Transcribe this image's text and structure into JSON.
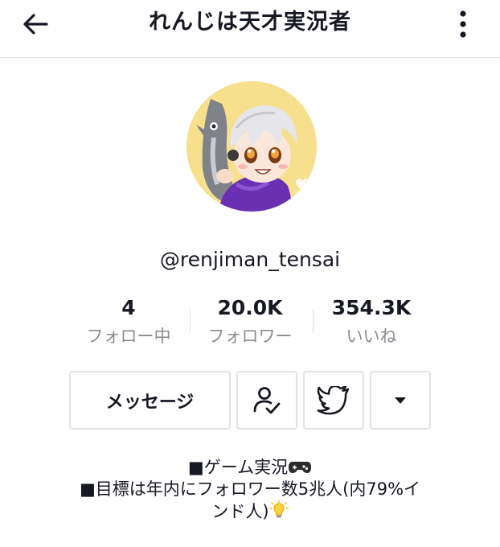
{
  "header": {
    "title": "れんじは天才実況者",
    "back_icon": "arrow-left-icon",
    "more_icon": "vertical-dots-icon"
  },
  "profile": {
    "avatar_icon": "anime-avatar-with-shark",
    "username": "@renjiman_tensai"
  },
  "stats": [
    {
      "value": "4",
      "label": "フォロー中"
    },
    {
      "value": "20.0K",
      "label": "フォロワー"
    },
    {
      "value": "354.3K",
      "label": "いいね"
    }
  ],
  "actions": {
    "message_label": "メッセージ",
    "follow_icon": "person-check-icon",
    "twitter_icon": "twitter-bird-icon",
    "dropdown_icon": "triangle-down-icon"
  },
  "bio": {
    "line1": "■ゲーム実況",
    "line1_icon": "game-controller-icon",
    "line2": "■目標は年内にフォロワー数5兆人(内79%イ",
    "line3": "ンド人)",
    "line3_icon": "light-bulb-icon"
  },
  "colors": {
    "text": "#161823",
    "secondary_text": "#8a8b91",
    "border": "#e3e3e4",
    "avatar_bg": "#f6e08e",
    "hoodie": "#6a2fb3"
  }
}
